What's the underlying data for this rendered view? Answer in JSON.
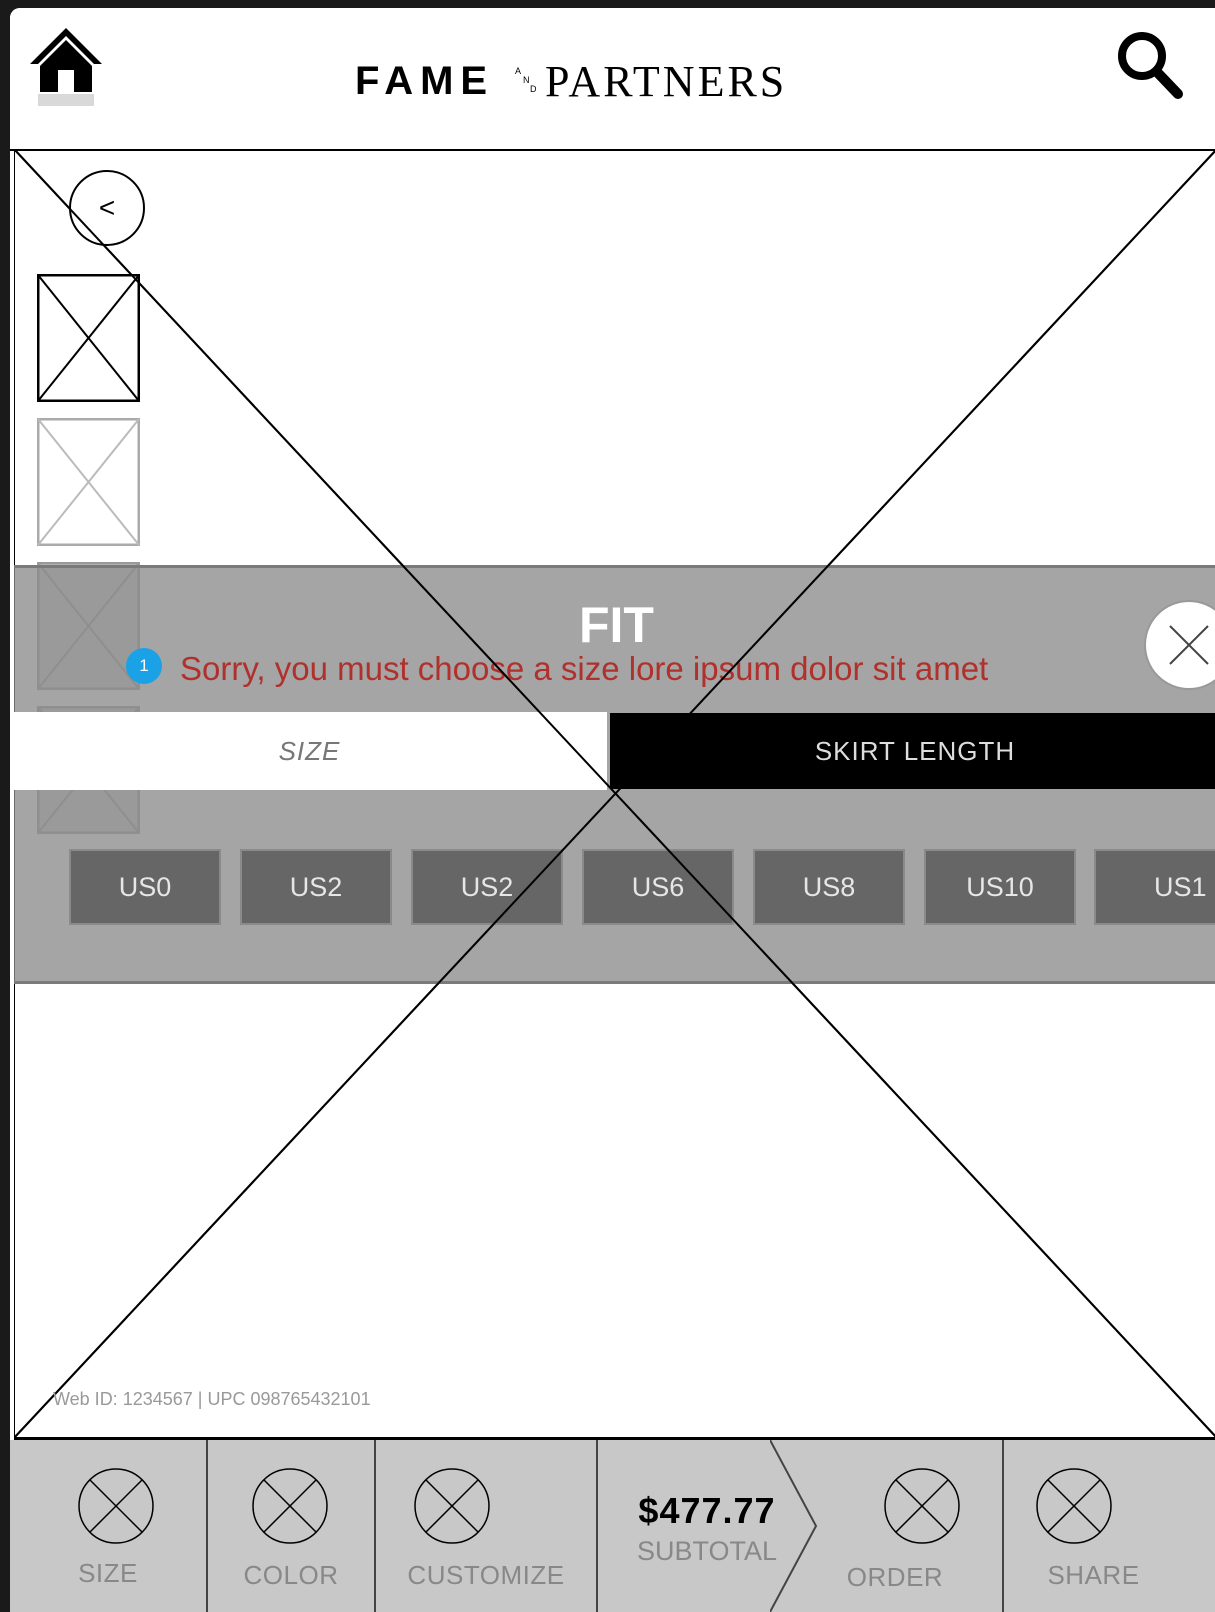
{
  "header": {
    "logo_text": "FAME AND PARTNERS",
    "icons": {
      "home": "home-icon",
      "search": "search-icon"
    }
  },
  "gallery": {
    "back_label": "<"
  },
  "fit_panel": {
    "title": "FIT",
    "error_message": "Sorry, you must choose a size lore ipsum dolor sit amet",
    "error_badge": "1",
    "error_color": "#b0302c",
    "badge_color": "#1aa1e6",
    "tabs": [
      {
        "label": "SIZE",
        "active": true
      },
      {
        "label": "SKIRT LENGTH",
        "active": false
      }
    ],
    "sizes": [
      "US0",
      "US2",
      "US2",
      "US6",
      "US8",
      "US10",
      "US1"
    ]
  },
  "product": {
    "ids": "Web ID: 1234567  | UPC 098765432101"
  },
  "bottom_bar": {
    "size_label": "SIZE",
    "color_label": "COLOR",
    "customize_label": "CUSTOMIZE",
    "price": "$477.77",
    "subtotal_label": "SUBTOTAL",
    "order_label": "ORDER",
    "share_label": "SHARE"
  }
}
